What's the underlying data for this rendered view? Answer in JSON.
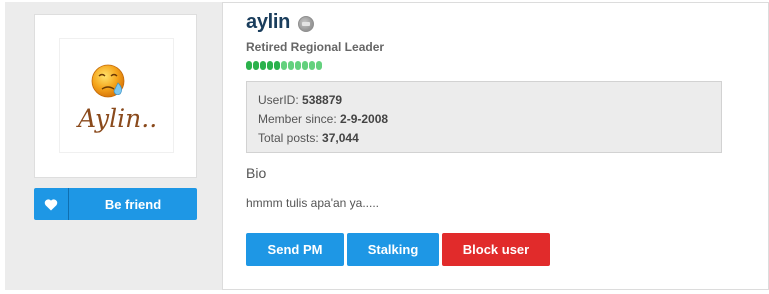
{
  "profile": {
    "username": "aylin",
    "rank_title": "Retired Regional Leader",
    "reputation_pips": 11,
    "online_status": "offline"
  },
  "avatar": {
    "text": "Aylin.."
  },
  "info": {
    "userid_label": "UserID:",
    "userid_value": "538879",
    "member_since_label": "Member since:",
    "member_since_value": "2-9-2008",
    "total_posts_label": "Total posts:",
    "total_posts_value": "37,044"
  },
  "bio": {
    "label": "Bio",
    "text": "hmmm tulis apa'an ya....."
  },
  "actions": {
    "befriend_label": "Be friend",
    "send_pm_label": "Send PM",
    "stalking_label": "Stalking",
    "block_user_label": "Block user"
  },
  "colors": {
    "primary_button": "#1e97e5",
    "danger_button": "#e12b2b",
    "username": "#1a3d5c",
    "reputation": "#2bb24c"
  },
  "icons": {
    "befriend": "heart-icon",
    "status": "offline-status-icon"
  }
}
